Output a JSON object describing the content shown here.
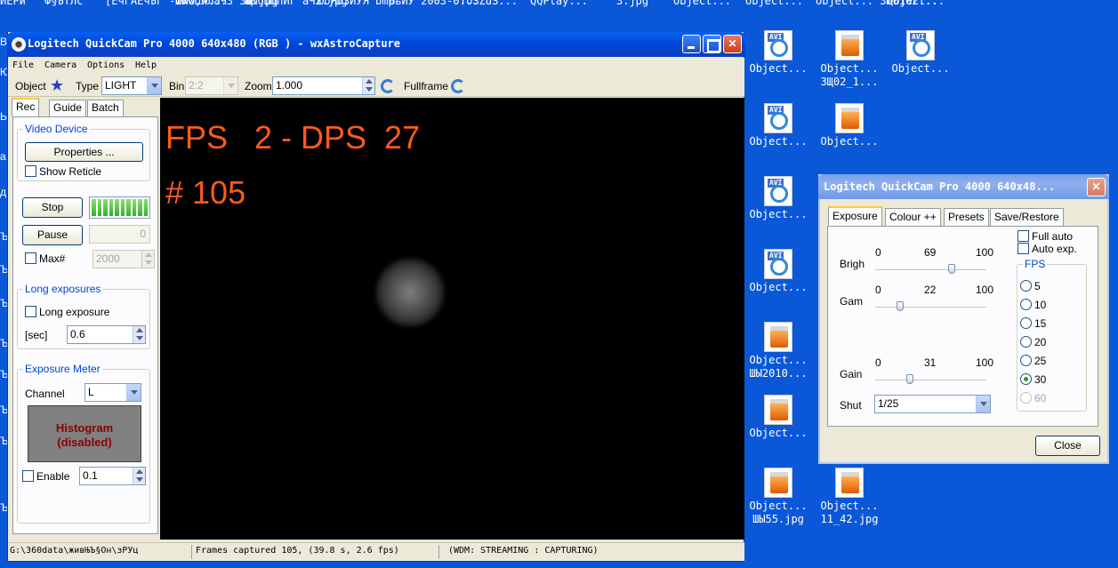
{
  "desktop": {
    "top_labels": [
      {
        "text": "ЙЁРй"
      },
      {
        "text": "Ф§ЪТЛс"
      },
      {
        "text": "[ЕчгАЕчЪг\n-www.w..."
      },
      {
        "text": "ШЫОЏЛЛаЧ3\nЗЩ.jpg"
      },
      {
        "text": "ШЫОЏЦпИг\nаЧ2.jpg"
      },
      {
        "text": "ЮоЯоЗЙУЯ\nbmp"
      },
      {
        "text": "ЬьЙУ\n2003-0..."
      },
      {
        "text": "ToSZdS..."
      },
      {
        "text": "QQPlay..."
      },
      {
        "text": "3.jpg"
      },
      {
        "text": "Object..."
      },
      {
        "text": "Object..."
      },
      {
        "text": "Object...\nЗЩ0102..."
      },
      {
        "text": "Object..."
      }
    ],
    "icons": [
      {
        "type": "avi",
        "tag": "AVI",
        "label": "Object..."
      },
      {
        "type": "img",
        "label": "Object...\nЗЩ02_1..."
      },
      {
        "type": "avi",
        "tag": "AVI",
        "label": "Object..."
      },
      {
        "type": "avi",
        "tag": "AVI",
        "label": "Object..."
      },
      {
        "type": "img",
        "label": "Object..."
      },
      {
        "type": "avi",
        "tag": "AVI",
        "label": "Object..."
      },
      {
        "type": "avi",
        "tag": "AVI",
        "label": "Object..."
      },
      {
        "type": "img",
        "label": "Object...\nШЫ2010..."
      },
      {
        "type": "img",
        "label": "Object..."
      },
      {
        "type": "img",
        "label": "Object...\nШЫ55.jpg"
      },
      {
        "type": "img",
        "label": "Object...\n11_42.jpg"
      }
    ],
    "left_edge": [
      "ВЅ",
      "ЮФ",
      "Ы",
      "а",
      "д",
      "Ъ",
      "Ъ",
      "Ъ",
      "Ъ",
      "Ъ",
      "Ъ",
      "Ъ",
      "Ъ"
    ]
  },
  "window": {
    "title": "Logitech QuickCam Pro 4000 640x480 (RGB ) - wxAstroCapture",
    "menu": [
      "File",
      "Camera",
      "Options",
      "Help"
    ],
    "toolbar": {
      "object_label": "Object",
      "type_label": "Type",
      "type_value": "LIGHT",
      "bin_label": "Bin",
      "bin_value": "2:2",
      "zoom_label": "Zoom",
      "zoom_value": "1.000",
      "fullframe_label": "Fullframe"
    },
    "tabs": [
      "Rec",
      "Guide",
      "Batch"
    ],
    "rec": {
      "video_device_title": "Video Device",
      "properties_button": "Properties ...",
      "show_reticle": "Show Reticle",
      "stop_button": "Stop",
      "pause_button": "Pause",
      "pause_value": "0",
      "max_label": "Max#",
      "max_value": "2000",
      "long_exposures_title": "Long exposures",
      "long_exposure_label": "Long exposure",
      "sec_label": "[sec]",
      "sec_value": "0.6",
      "exposure_meter_title": "Exposure Meter",
      "channel_label": "Channel",
      "channel_value": "L",
      "histogram_text": "Histogram\n(disabled)",
      "enable_label": "Enable",
      "enable_value": "0.1"
    },
    "video": {
      "fps_text": "FPS   2 - DPS  27",
      "frame_text": "# 105"
    },
    "status": {
      "path": "G:\\360data\\живЊЪ§Он\\зРУц",
      "frames": "Frames captured 105, (39.8 s, 2.6 fps)",
      "wdm": "(WDM: STREAMING : CAPTURING)"
    }
  },
  "dialog": {
    "title": "Logitech QuickCam Pro 4000 640x48...",
    "tabs": [
      "Exposure",
      "Colour ++",
      "Presets",
      "Save/Restore"
    ],
    "sliders": [
      {
        "label": "Brigh",
        "min": "0",
        "value": 69,
        "max": "100"
      },
      {
        "label": "Gam",
        "min": "0",
        "value": 22,
        "max": "100"
      },
      {
        "label": "Gain",
        "min": "0",
        "value": 31,
        "max": "100"
      }
    ],
    "shut_label": "Shut",
    "shut_value": "1/25",
    "full_auto": "Full auto",
    "auto_exp": "Auto exp.",
    "fps_title": "FPS",
    "fps_options": [
      "5",
      "10",
      "15",
      "20",
      "25",
      "30",
      "60"
    ],
    "fps_selected": "30",
    "close_button": "Close"
  }
}
